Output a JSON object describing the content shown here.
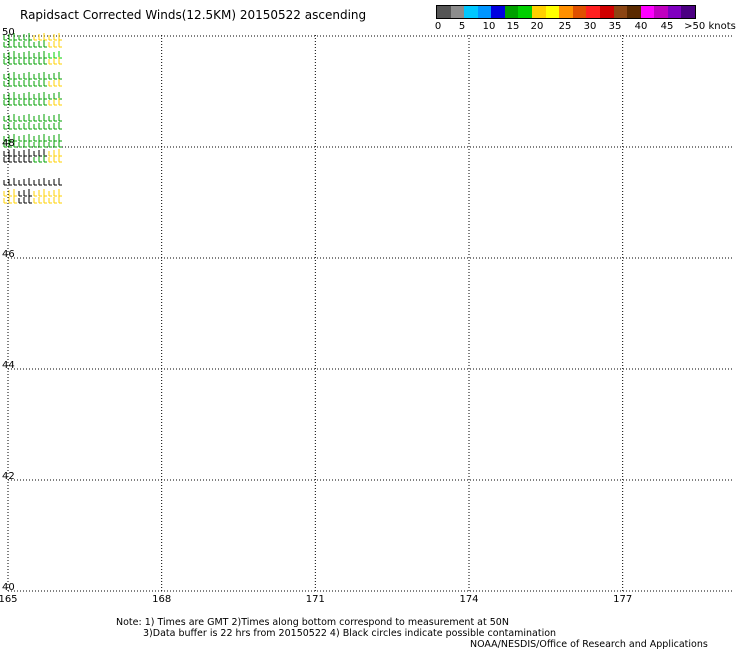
{
  "title": "Rapidsact Corrected Winds(12.5KM) 20150522 ascending",
  "legend": {
    "colors": [
      "#555555",
      "#8c8c8c",
      "#00c8ff",
      "#0096ff",
      "#0000e0",
      "#00a000",
      "#00d000",
      "#ffd000",
      "#ffff00",
      "#ff9000",
      "#e05000",
      "#ff2020",
      "#d00000",
      "#8b4513",
      "#5a2a00",
      "#ff00ff",
      "#c000c0",
      "#8000c0",
      "#4b0082"
    ],
    "labels": [
      "0",
      "5",
      "10",
      "15",
      "20",
      "25",
      "30",
      "35",
      "40",
      "45",
      ">50 knots"
    ]
  },
  "map": {
    "lon_ticks": [
      "165",
      "168",
      "171",
      "174",
      "177"
    ],
    "lat_ticks": [
      "40",
      "42",
      "44",
      "46",
      "48",
      "50"
    ],
    "lon_range": [
      165,
      179
    ],
    "lat_range": [
      40,
      50
    ],
    "grid": true
  },
  "notes": {
    "line1": "Note: 1) Times are GMT 2)Times along bottom correspond to measurement at 50N",
    "line2": "3)Data buffer is 22 hrs from 20150522 4) Black circles indicate possible contamination",
    "line3": "NOAA/NESDIS/Office of Research and Applications"
  }
}
